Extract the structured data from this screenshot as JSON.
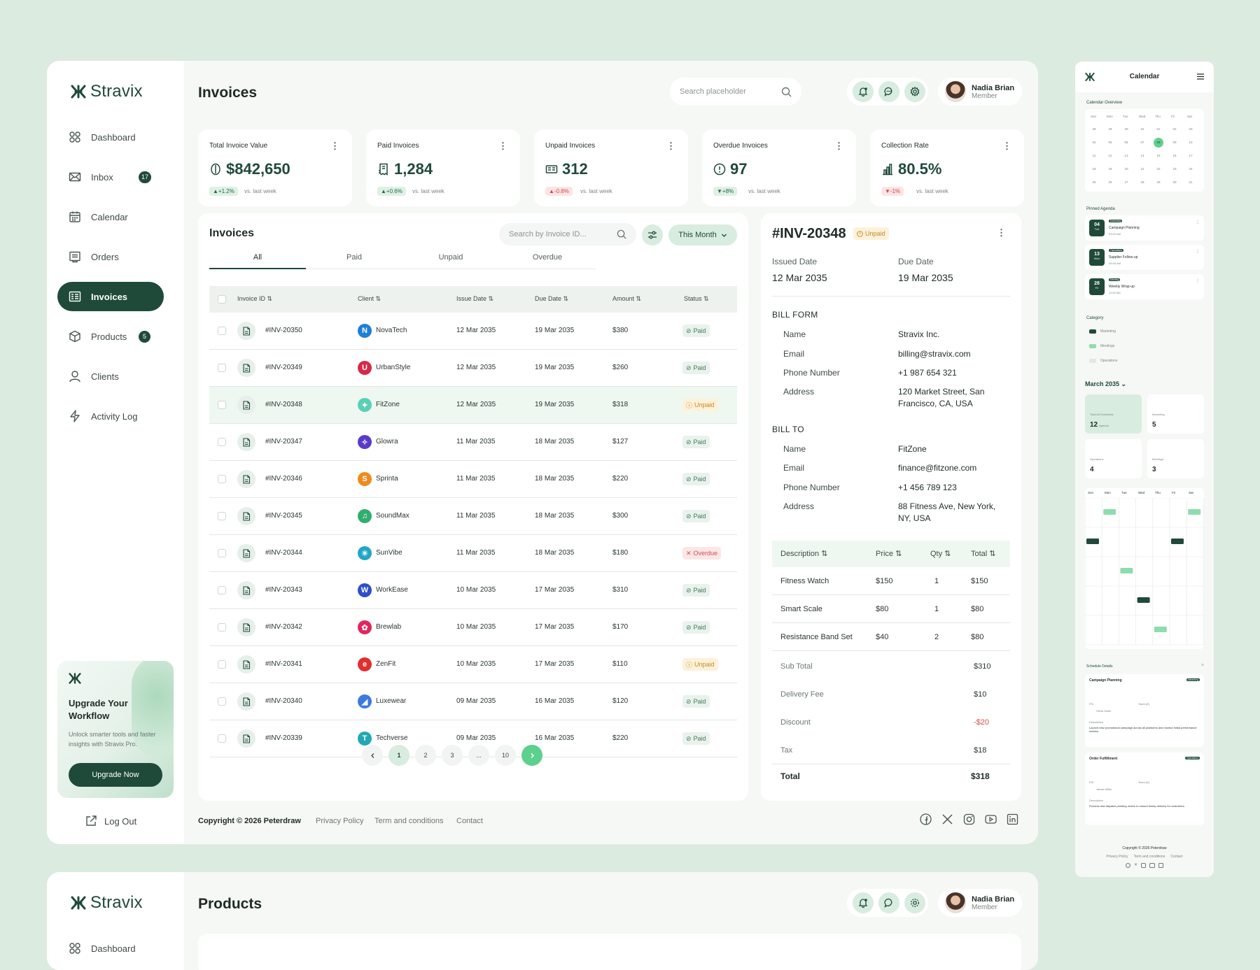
{
  "brand": "Stravix",
  "nav": [
    {
      "label": "Dashboard",
      "icon": "grid-icon",
      "badge": ""
    },
    {
      "label": "Inbox",
      "icon": "mail-icon",
      "badge": "17"
    },
    {
      "label": "Calendar",
      "icon": "calendar-icon",
      "badge": ""
    },
    {
      "label": "Orders",
      "icon": "orders-icon",
      "badge": ""
    },
    {
      "label": "Invoices",
      "icon": "invoice-icon",
      "badge": ""
    },
    {
      "label": "Products",
      "icon": "box-icon",
      "badge": "5"
    },
    {
      "label": "Clients",
      "icon": "user-icon",
      "badge": ""
    },
    {
      "label": "Activity Log",
      "icon": "bolt-icon",
      "badge": ""
    }
  ],
  "upgrade": {
    "title": "Upgrade Your Workflow",
    "text": "Unlock smarter tools and faster insights with Stravix Pro.",
    "button": "Upgrade Now"
  },
  "logout": "Log Out",
  "header": {
    "title": "Invoices",
    "search_placeholder": "Search placeholder",
    "user_name": "Nadia Brian",
    "user_role": "Member"
  },
  "stats": [
    {
      "label": "Total Invoice Value",
      "value": "$842,650",
      "change": "▲+1.2%",
      "trend": "up",
      "icon": "coin-icon"
    },
    {
      "label": "Paid Invoices",
      "value": "1,284",
      "change": "▲+0.6%",
      "trend": "up",
      "icon": "receipt-icon"
    },
    {
      "label": "Unpaid Invoices",
      "value": "312",
      "change": "▲-0.8%",
      "trend": "down",
      "icon": "bill-icon"
    },
    {
      "label": "Overdue Invoices",
      "value": "97",
      "change": "▼+8%",
      "trend": "up",
      "icon": "alert-icon"
    },
    {
      "label": "Collection Rate",
      "value": "80.5%",
      "change": "▼-1%",
      "trend": "down",
      "icon": "bars-icon"
    }
  ],
  "vs_label": "vs. last week",
  "list": {
    "title": "Invoices",
    "search_placeholder": "Search by Invoice ID...",
    "period": "This Month",
    "tabs": [
      "All",
      "Paid",
      "Unpaid",
      "Overdue"
    ],
    "columns": [
      "Invoice ID",
      "Client",
      "Issue Date",
      "Due Date",
      "Amount",
      "Status"
    ],
    "rows": [
      {
        "id": "#INV-20350",
        "client": "NovaTech",
        "logo": "N",
        "color": "#1e7fd6",
        "issue": "12 Mar 2035",
        "due": "19 Mar 2035",
        "amount": "$380",
        "status": "Paid"
      },
      {
        "id": "#INV-20349",
        "client": "UrbanStyle",
        "logo": "U",
        "color": "#d6294a",
        "issue": "12 Mar 2035",
        "due": "19 Mar 2035",
        "amount": "$260",
        "status": "Paid"
      },
      {
        "id": "#INV-20348",
        "client": "FitZone",
        "logo": "✦",
        "color": "#5ccfb7",
        "issue": "12 Mar 2035",
        "due": "19 Mar 2035",
        "amount": "$318",
        "status": "Unpaid"
      },
      {
        "id": "#INV-20347",
        "client": "Glowra",
        "logo": "✧",
        "color": "#5a3bc9",
        "issue": "11 Mar 2035",
        "due": "18 Mar 2035",
        "amount": "$127",
        "status": "Paid"
      },
      {
        "id": "#INV-20346",
        "client": "Sprinta",
        "logo": "S",
        "color": "#f08a1e",
        "issue": "11 Mar 2035",
        "due": "18 Mar 2035",
        "amount": "$220",
        "status": "Paid"
      },
      {
        "id": "#INV-20345",
        "client": "SoundMax",
        "logo": "♫",
        "color": "#2fae6f",
        "issue": "11 Mar 2035",
        "due": "18 Mar 2035",
        "amount": "$300",
        "status": "Paid"
      },
      {
        "id": "#INV-20344",
        "client": "SunVibe",
        "logo": "☀",
        "color": "#21a6c9",
        "issue": "11 Mar 2035",
        "due": "18 Mar 2035",
        "amount": "$180",
        "status": "Overdue"
      },
      {
        "id": "#INV-20343",
        "client": "WorkEase",
        "logo": "W",
        "color": "#2f4fc9",
        "issue": "10 Mar 2035",
        "due": "17 Mar 2035",
        "amount": "$310",
        "status": "Paid"
      },
      {
        "id": "#INV-20342",
        "client": "Brewlab",
        "logo": "✿",
        "color": "#e0265e",
        "issue": "10 Mar 2035",
        "due": "17 Mar 2035",
        "amount": "$170",
        "status": "Paid"
      },
      {
        "id": "#INV-20341",
        "client": "ZenFit",
        "logo": "e",
        "color": "#e02f2f",
        "issue": "10 Mar 2035",
        "due": "17 Mar 2035",
        "amount": "$110",
        "status": "Unpaid"
      },
      {
        "id": "#INV-20340",
        "client": "Luxewear",
        "logo": "◢",
        "color": "#3b7be0",
        "issue": "09 Mar 2035",
        "due": "16 Mar 2035",
        "amount": "$120",
        "status": "Paid"
      },
      {
        "id": "#INV-20339",
        "client": "Techverse",
        "logo": "T",
        "color": "#22a7b4",
        "issue": "09 Mar 2035",
        "due": "16 Mar 2035",
        "amount": "$220",
        "status": "Paid"
      }
    ],
    "pages": [
      "1",
      "2",
      "3",
      "...",
      "10"
    ]
  },
  "detail": {
    "id": "#INV-20348",
    "status": "Unpaid",
    "issued_label": "Issued Date",
    "issued": "12 Mar 2035",
    "due_label": "Due Date",
    "due": "19 Mar 2035",
    "bill_from_title": "BILL FORM",
    "bill_from": [
      {
        "k": "Name",
        "v": "Stravix Inc."
      },
      {
        "k": "Email",
        "v": "billing@stravix.com"
      },
      {
        "k": "Phone Number",
        "v": "+1 987 654 321"
      },
      {
        "k": "Address",
        "v": "120 Market Street, San Francisco, CA, USA"
      }
    ],
    "bill_to_title": "BILL TO",
    "bill_to": [
      {
        "k": "Name",
        "v": "FitZone"
      },
      {
        "k": "Email",
        "v": "finance@fitzone.com"
      },
      {
        "k": "Phone Number",
        "v": "+1 456 789 123"
      },
      {
        "k": "Address",
        "v": "88 Fitness Ave, New York, NY, USA"
      }
    ],
    "item_cols": [
      "Description",
      "Price",
      "Qty",
      "Total"
    ],
    "items": [
      {
        "d": "Fitness Watch",
        "p": "$150",
        "q": "1",
        "t": "$150"
      },
      {
        "d": "Smart Scale",
        "p": "$80",
        "q": "1",
        "t": "$80"
      },
      {
        "d": "Resistance Band Set",
        "p": "$40",
        "q": "2",
        "t": "$80"
      }
    ],
    "summary": [
      {
        "k": "Sub Total",
        "v": "$310"
      },
      {
        "k": "Delivery Fee",
        "v": "$10"
      },
      {
        "k": "Discount",
        "v": "-$20"
      },
      {
        "k": "Tax",
        "v": "$18"
      }
    ],
    "total_label": "Total",
    "total": "$318"
  },
  "footer": {
    "copyright": "Copyright © 2026 Peterdraw",
    "links": [
      "Privacy Policy",
      "Term and conditions",
      "Contact"
    ]
  },
  "products_preview": {
    "title": "Products",
    "nav_first": "Dashboard",
    "user_name": "Nadia Brian",
    "user_role": "Member"
  },
  "mini": {
    "title": "Calendar",
    "overview": "Calendar Overview",
    "weekdays": [
      "Sun",
      "Mon",
      "Tue",
      "Wed",
      "Thu",
      "Fri",
      "Sat"
    ],
    "days": [
      "28",
      "29",
      "30",
      "31",
      "01",
      "02",
      "03",
      "04",
      "05",
      "06",
      "07",
      "08",
      "09",
      "10",
      "11",
      "12",
      "13",
      "14",
      "15",
      "16",
      "17",
      "18",
      "19",
      "20",
      "21",
      "22",
      "23",
      "24",
      "25",
      "26",
      "27",
      "28",
      "29",
      "30",
      "31"
    ],
    "pinned": "Pinned Agenda",
    "agenda": [
      {
        "day": "04",
        "wd": "Tue",
        "tag": "Marketing",
        "title": "Campaign Planning",
        "time": "09:00 AM"
      },
      {
        "day": "13",
        "wd": "Mon",
        "tag": "Operations",
        "title": "Supplier Follow-up",
        "time": "09:30 AM"
      },
      {
        "day": "28",
        "wd": "Fri",
        "tag": "Meeting",
        "title": "Weekly Wrap-up",
        "time": "11:00 AM"
      }
    ],
    "category": "Category",
    "categories": [
      "Marketing",
      "Meetings",
      "Operations"
    ],
    "month": "March 2035",
    "tiles": [
      {
        "l": "Total All Schedules",
        "v": "12",
        "s": "Agenda"
      },
      {
        "l": "Marketing",
        "v": "5",
        "s": ""
      },
      {
        "l": "Operations",
        "v": "4",
        "s": ""
      },
      {
        "l": "Meetings",
        "v": "3",
        "s": ""
      }
    ],
    "schedule_details": "Schedule Details",
    "sched": [
      {
        "title": "Campaign Planning",
        "tag": "Marketing",
        "pic": "Olivia Smith",
        "desc_label": "Description",
        "desc": "Launch new promotional campaign across all platforms and monitor initial performance metrics."
      },
      {
        "title": "Order Fulfillment",
        "tag": "Operations",
        "pic": "James Miller",
        "desc_label": "Description",
        "desc": "Process and dispatch pending orders to ensure timely delivery for customers."
      }
    ],
    "pic_label": "PIC",
    "team_label": "Team (8)",
    "copyright": "Copyright © 2026 Peterdraw",
    "links": [
      "Privacy Policy",
      "Term and conditions",
      "Contact"
    ]
  }
}
